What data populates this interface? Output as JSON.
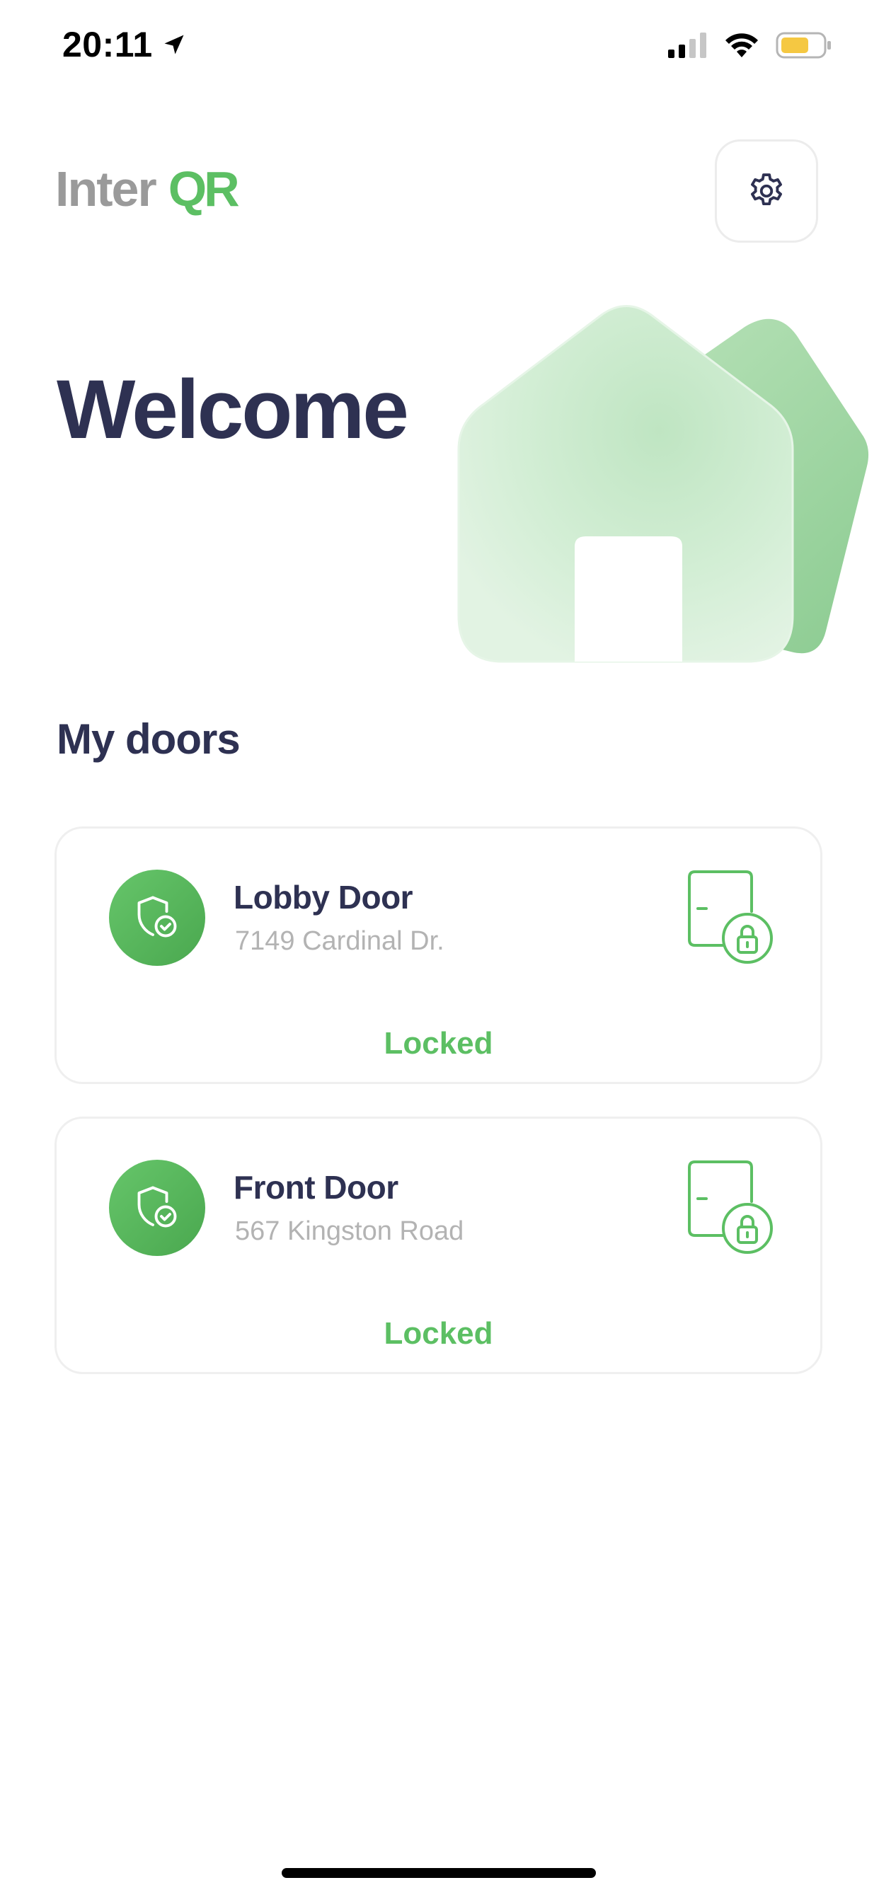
{
  "status_bar": {
    "time": "20:11",
    "icons": [
      "location-arrow-icon",
      "cellular-signal-icon",
      "wifi-icon",
      "battery-icon"
    ],
    "battery_color": "#f5c842"
  },
  "header": {
    "logo_part1": "Inter",
    "logo_part2": "QR",
    "settings_icon": "gear-icon"
  },
  "hero": {
    "title": "Welcome",
    "illustration": "house-illustration"
  },
  "doors_section": {
    "title": "My doors",
    "doors": [
      {
        "name": "Lobby Door",
        "address": "7149 Cardinal Dr.",
        "status": "Locked",
        "icon": "shield-check-icon",
        "lock_icon": "door-locked-icon"
      },
      {
        "name": "Front Door",
        "address": "567 Kingston Road",
        "status": "Locked",
        "icon": "shield-check-icon",
        "lock_icon": "door-locked-icon"
      }
    ]
  },
  "colors": {
    "accent": "#5cbf63",
    "text_dark": "#2e3152",
    "text_muted": "#b3b3b3",
    "logo_gray": "#9a9a9a"
  }
}
